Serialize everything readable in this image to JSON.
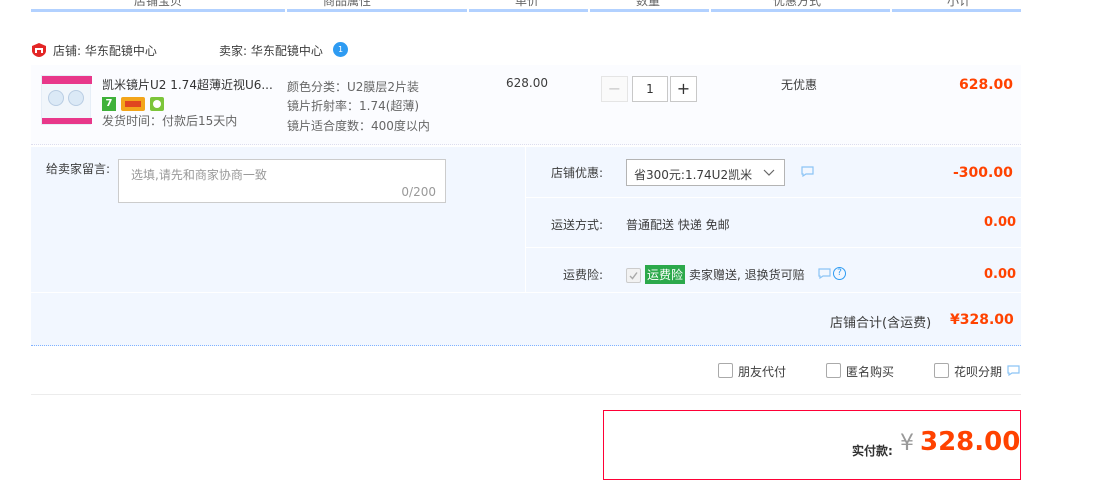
{
  "columns": [
    "店铺宝贝",
    "商品属性",
    "单价",
    "数量",
    "优惠方式",
    "小计"
  ],
  "shop": {
    "shop_label": "店铺: 华东配镜中心",
    "seller_label": "卖家: 华东配镜中心",
    "wangwang_badge": "1"
  },
  "item": {
    "title": "凯米镜片U2 1.74超薄近视U6...",
    "ship_time": "发货时间：付款后15天内",
    "attrs": [
      "颜色分类：U2膜层2片装",
      "镜片折射率：1.74(超薄)",
      "镜片适合度数：400度以内"
    ],
    "price": "628.00",
    "quantity": "1",
    "minus": "−",
    "plus": "+",
    "discount": "无优惠",
    "subtotal": "628.00",
    "badges": [
      {
        "name": "seven-day-return-icon",
        "text": "7",
        "color": "#3fb13a"
      },
      {
        "name": "credit-card-icon",
        "text": "",
        "color": "#f3a51a"
      },
      {
        "name": "guarantee-icon",
        "text": "",
        "color": "#7cc53a"
      }
    ]
  },
  "memo": {
    "label": "给卖家留言:",
    "placeholder": "选填,请先和商家协商一致",
    "counter": "0/200"
  },
  "store_discount": {
    "label": "店铺优惠:",
    "selected": "省300元:1.74U2凯米",
    "amount": "-300.00"
  },
  "shipping": {
    "label": "运送方式:",
    "value": "普通配送 快递 免邮",
    "amount": "0.00"
  },
  "insurance": {
    "label": "运费险:",
    "tag": "运费险",
    "text": "卖家赠送, 退换货可赔",
    "amount": "0.00"
  },
  "store_total": {
    "label": "店铺合计(含运费)",
    "value": "¥328.00"
  },
  "options": [
    "朋友代付",
    "匿名购买",
    "花呗分期"
  ],
  "payment": {
    "label": "实付款:",
    "currency": "¥",
    "amount": "328.00"
  },
  "colors": {
    "accent_red": "#ff4200",
    "panel_blue": "#f2f7ff",
    "tag_green": "#2ca94b"
  }
}
